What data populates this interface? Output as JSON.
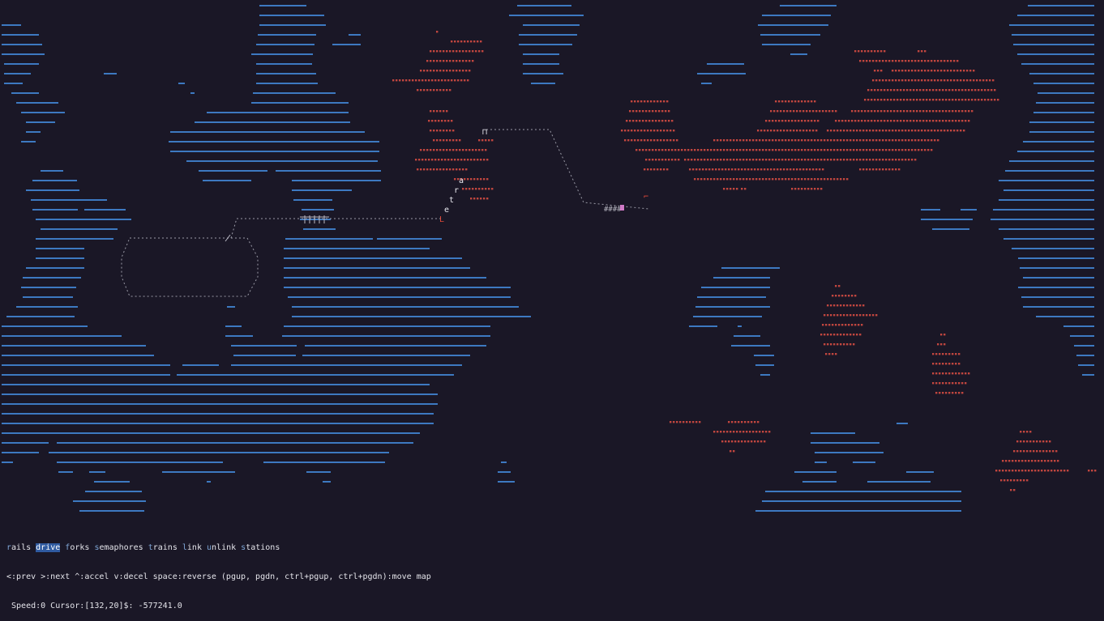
{
  "app": {
    "colors": {
      "background": "#1a1726",
      "water": "#3d79c1",
      "land": "#c1463f",
      "track": "#9a9aa6",
      "active_mode": "#2f5aa0"
    }
  },
  "map": {
    "train_letters": [
      "a",
      "r",
      "t",
      "e"
    ],
    "train_head": "L",
    "track_marks": "####",
    "signal_glyph": "⊓"
  },
  "menu": {
    "modes": [
      {
        "key": "r",
        "rest": "ails",
        "active": false
      },
      {
        "key": "d",
        "rest": "rive",
        "active": true
      },
      {
        "key": "f",
        "rest": "orks",
        "active": false
      },
      {
        "key": "s",
        "rest": "emaphores",
        "active": false
      },
      {
        "key": "t",
        "rest": "rains",
        "active": false
      },
      {
        "key": "l",
        "rest": "ink",
        "active": false
      },
      {
        "key": "u",
        "rest": "nlink",
        "active": false
      },
      {
        "key": "s",
        "rest": "tations",
        "active": false
      }
    ],
    "help": "<:prev >:next ^:accel v:decel space:reverse (pgup, pgdn, ctrl+pgup, ctrl+pgdn):move map",
    "status": " Speed:0 Cursor:[132,20]$: -577241.0"
  }
}
